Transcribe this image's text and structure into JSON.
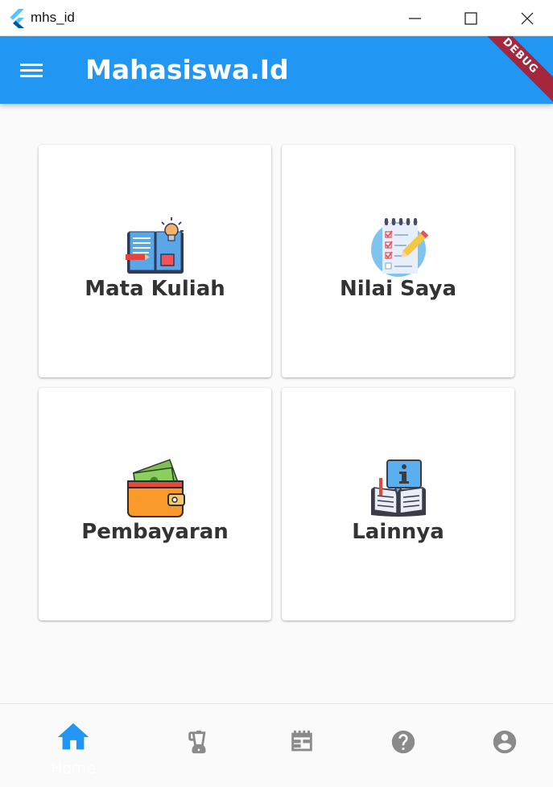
{
  "window": {
    "title": "mhs_id"
  },
  "appbar": {
    "title": "Mahasiswa.Id",
    "debug_label": "DEBUG",
    "color": "#2196f3"
  },
  "menu": [
    {
      "label": "Mata Kuliah",
      "icon": "book-lightbulb-icon"
    },
    {
      "label": "Nilai Saya",
      "icon": "checklist-notepad-icon"
    },
    {
      "label": "Pembayaran",
      "icon": "wallet-money-icon"
    },
    {
      "label": "Lainnya",
      "icon": "info-book-icon"
    }
  ],
  "bottom_nav": {
    "items": [
      {
        "label": "Home",
        "icon": "home-icon",
        "active": true
      },
      {
        "label": "",
        "icon": "blender-icon"
      },
      {
        "label": "",
        "icon": "calendar-table-icon"
      },
      {
        "label": "",
        "icon": "help-icon"
      },
      {
        "label": "",
        "icon": "account-icon"
      }
    ],
    "active_color": "#2196f3",
    "inactive_color": "#8a8a8a"
  }
}
